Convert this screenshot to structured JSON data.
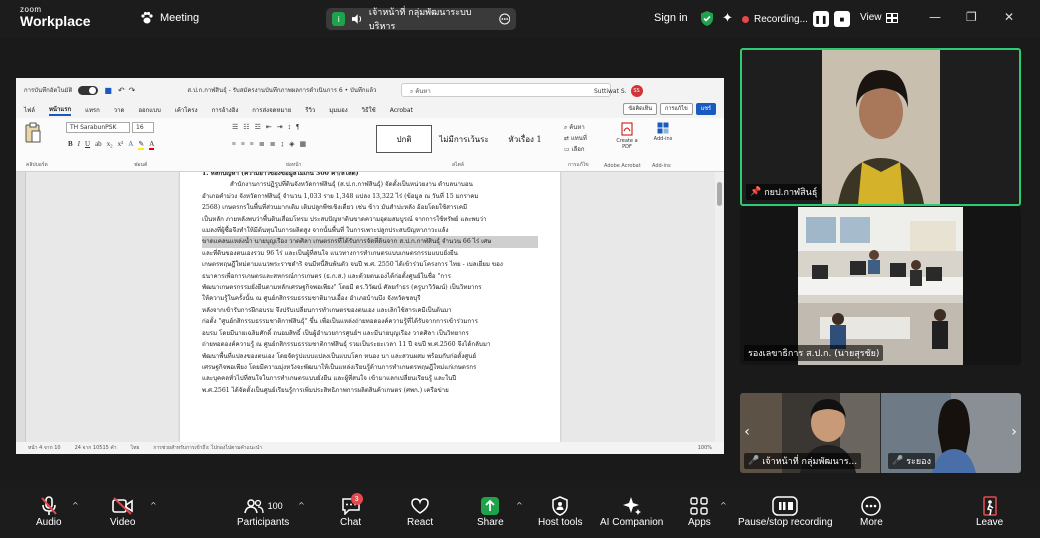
{
  "titlebar": {
    "logo_top": "zoom",
    "logo_bottom": "Workplace",
    "meeting_label": "Meeting",
    "share_badge": "i",
    "share_name": "เจ้าหน้าที่ กลุ่มพัฒนาระบบบริหาร",
    "sign_in": "Sign in",
    "recording_label": "Recording...",
    "view_label": "View"
  },
  "word": {
    "autosave_label": "การบันทึกอัตโนมัติ",
    "doc_title": "ส.ป.ก.กาฬสินธุ์ - รับสมัครงานบันทึกภาพผลการดำเนินการ 6 • บันทึกแล้ว",
    "search_placeholder": "ค้นหา",
    "user_name": "Suttiwat S.",
    "user_initials": "SS",
    "tabs": [
      "ไฟล์",
      "หน้าแรก",
      "แทรก",
      "วาด",
      "ออกแบบ",
      "เค้าโครง",
      "การอ้างอิง",
      "การส่งจดหมาย",
      "รีวิว",
      "มุมมอง",
      "วิธีใช้",
      "Acrobat"
    ],
    "active_tab": "หน้าแรก",
    "btn_comments": "ข้อคิดเห็น",
    "btn_editing": "การแก้ไข",
    "btn_share": "แชร์",
    "font_name": "TH SarabunPSK",
    "font_size": "16",
    "style_normal": "ปกติ",
    "style_nospace": "ไม่มีการเว้นระ",
    "style_heading": "หัวเรื่อง 1",
    "group_clipboard": "คลิปบอร์ด",
    "group_font": "ฟอนต์",
    "group_paragraph": "ย่อหน้า",
    "group_styles": "สไตล์",
    "group_editing": "การแก้ไข",
    "group_acrobat": "Adobe Acrobat",
    "group_addins": "Add-ins",
    "find": "ค้นหา",
    "replace": "แทนที่",
    "select": "เลือก",
    "create_pdf": "Create a PDF",
    "addins": "Add-ins",
    "status_page": "หน้า 4 จาก 10",
    "status_words": "24 จาก 10515 คำ",
    "status_lang": "ไทย",
    "status_access": "การช่วยสำหรับการเข้าถึง: ไปกองไปตามคำแนะนำ",
    "status_zoom": "100%",
    "doc_lines": [
      "1. หลักปัญหา (ความยาวของข้อมูลไม่เกิน 300 คำ/สไลด์)",
      "สำนักงานการปฏิรูปที่ดินจังหวัดกาฬสินธุ์ (ส.ป.ก.กาฬสินธุ์) จัดตั้งเป็นหน่วยงาน ตำบลนาบอน",
      "อำเภอคำม่วง จังหวัดกาฬสินธุ์ จำนวน 1,033 ราย 1,348 แปลง 13,322 ไร่ (ข้อมูล ณ วันที่ 15 มกราคม",
      "2568) เกษตรกรในพื้นที่ส่วนมากเดิม เดิมปลูกพืชเชิงเดี่ยว เช่น ข้าว มันสำปะหลัง อ้อยโดยใช้สารเคมี",
      "เป็นหลัก ภายหลังพบว่าพื้นดินเสื่อมโทรม ประสบปัญหาดินขาดความอุดมสมบูรณ์ จากการใช้ทรัพย์ และพบว่า",
      "แมลงที่ผู้ซื้อจึงทำให้มีต้นทุนในการผลิตสูง จากนั้นพื้นที่ ในการเพาะปลูกประสบปัญหาภาวะแล้ง",
      "ขาดแคลนแหล่งน้ำ นายบุญเรือง วาดศิลา เกษตรกรที่ได้รับการจัดที่ดินจาก ส.ป.ก.กาฬสินธุ์ จำนวน 66 ไร่ เศษ",
      "และที่ดินของตนเองรวม 96 ไร่ และเป็นผู้ที่สนใจ แนวทางการทำเกษตรแบบเกษตรกรรมแบบยั่งยืน",
      "เกษตรทฤษฎีใหม่ตามแนวพระราชดำริ จนมีหนี้สินพ้นตัว จนปี พ.ศ. 2550 ได้เข้าร่วมโครงการ ไทย - เบลเยี่ยม ของ",
      "ธนาคารเพื่อการเกษตรและสหกรณ์การเกษตร (ธ.ก.ส.) และด้วยตนเองได้ก่อตั้งศูนย์ในชื่อ \"การ",
      "พัฒนาเกษตรกรรมยั่งยืนตามหลักเศรษฐกิจพอเพียง\" โดยมี ดร.วิวัฒน์ ศัลยกำธร (ครูบาวิวัฒน์) เป็นวิทยากร",
      "ให้ความรู้ในครั้งนั้น ณ ศูนย์กสิกรรมธรรมชาติมาบเอื้อง อำเภอบ้านบึง จังหวัดชลบุรี",
      "หลังจากเข้ารับการฝึกอบรม จึงปรับเปลี่ยนการทำเกษตรของตนเอง และเลิกใช้สารเคมีเป็นต้นมา",
      "ก่อตั้ง \"ศูนย์กสิกรรมธรรมชาติกาฬสินธุ์\" ขึ้น เพื่อเป็นแหล่งถ่ายทอดองค์ความรู้ที่ได้รับจากการเข้าร่วมการ",
      "อบรม โดยมีนายเฉลิมศักดิ์ ถนอมสิทธิ์ เป็นผู้อำนวยการศูนย์ฯ และมีนายบุญเรือง วาดศิลา เป็นวิทยากร",
      "ถ่ายทอดองค์ความรู้ ณ ศูนย์กสิกรรมธรรมชาติกาฬสินธุ์ รวมเป็นระยะเวลา 11 ปี จนปี พ.ศ.2560 จึงได้กลับมา",
      "พัฒนาพื้นที่แปลงของตนเอง โดยจัดรูปแบบแปลงเป็นแบบโคก หนอง นา และสวนผสม พร้อมกับก่อตั้งศูนย์",
      "เศรษฐกิจพอเพียง โดยมีความมุ่งหวังจะพัฒนาให้เป็นแหล่งเรียนรู้ด้านการทำเกษตรทฤษฎีใหม่แก่เกษตรกร",
      "และบุคคลทั่วไปที่สนใจในการทำเกษตรแบบยั่งยืน และผู้ที่สนใจ เข้ามาแลกเปลี่ยนเรียนรู้ และในปี",
      "พ.ศ.2561 ได้จัดตั้งเป็นศูนย์เรียนรู้การเพิ่มประสิทธิภาพการผลิตสินค้าเกษตร (ศพก.) เครือข่าย"
    ],
    "highlight_line_index": 6
  },
  "tiles": {
    "active_name": "กยป.กาฬสินธุ์",
    "office_name": "รองเลขาธิการ ส.ป.ก. (นายสุรชัย)",
    "bottom_left_name": "เจ้าหน้าที่ กลุ่มพัฒนาร...",
    "bottom_right_name": "ระยอง"
  },
  "toolbar": {
    "audio": "Audio",
    "video": "Video",
    "participants": "Participants",
    "participant_count": "100",
    "chat": "Chat",
    "chat_badge": "3",
    "react": "React",
    "share": "Share",
    "host_tools": "Host tools",
    "ai_companion": "AI Companion",
    "apps": "Apps",
    "pause_recording": "Pause/stop recording",
    "more": "More",
    "leave": "Leave"
  },
  "colors": {
    "active_border": "#2ecc71",
    "share_green": "#1fa34a",
    "mute_red": "#e5484d",
    "leave_red": "#e5484d",
    "word_blue": "#185abd"
  }
}
